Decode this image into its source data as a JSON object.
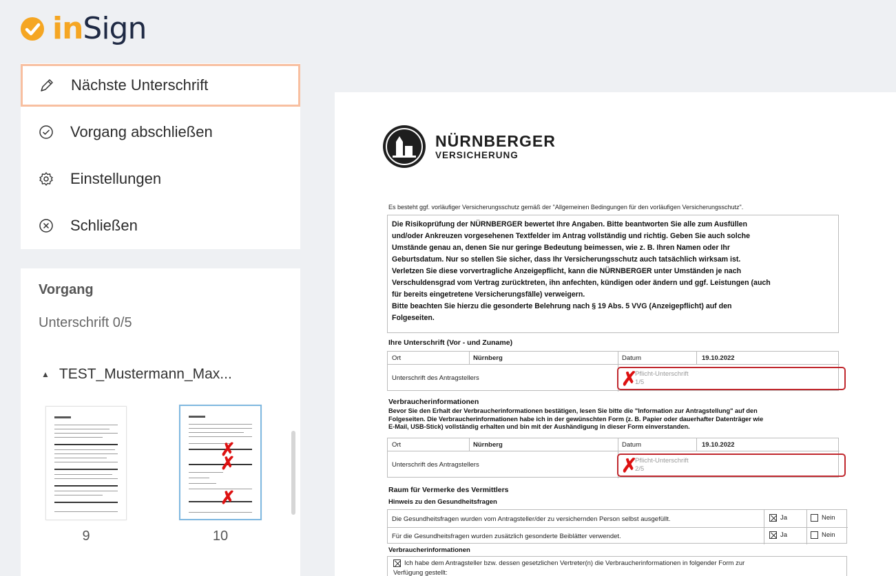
{
  "app": {
    "logo_in": "in",
    "logo_sign": "Sign"
  },
  "menu": {
    "items": [
      {
        "label": "Nächste Unterschrift",
        "icon": "pen-icon",
        "active": true
      },
      {
        "label": "Vorgang abschließen",
        "icon": "check-circle-icon"
      },
      {
        "label": "Einstellungen",
        "icon": "gear-icon"
      },
      {
        "label": "Schließen",
        "icon": "close-circle-icon"
      }
    ]
  },
  "process": {
    "title": "Vorgang",
    "signature_count": "Unterschrift 0/5",
    "document_name": "TEST_Mustermann_Max...",
    "pages": [
      {
        "number": "9"
      },
      {
        "number": "10",
        "selected": true
      }
    ]
  },
  "document": {
    "company_name": "NÜRNBERGER",
    "company_sub": "VERSICHERUNG",
    "intro": "Es besteht ggf. vorläufiger Versicherungsschutz gemäß der \"Allgemeinen Bedingungen für den vorläufigen Versicherungsschutz\".",
    "notice_lines": [
      "Die Risikoprüfung der NÜRNBERGER bewertet Ihre Angaben. Bitte beantworten Sie alle zum Ausfüllen",
      "und/oder Ankreuzen vorgesehenen Textfelder im Antrag vollständig und richtig. Geben Sie auch solche",
      "Umstände genau an, denen Sie nur geringe Bedeutung beimessen, wie z. B. Ihren Namen oder Ihr",
      "Geburtsdatum. Nur so stellen Sie sicher, dass Ihr Versicherungsschutz auch tatsächlich wirksam ist.",
      "Verletzen Sie diese vorvertragliche Anzeigepflicht, kann die NÜRNBERGER unter Umständen je nach",
      "Verschuldensgrad vom Vertrag zurücktreten, ihn anfechten, kündigen oder ändern und ggf. Leistungen (auch",
      "für bereits eingetretene Versicherungsfälle) verweigern.",
      "Bitte beachten Sie hierzu die gesonderte Belehrung nach § 19 Abs. 5 VVG (Anzeigepflicht) auf den",
      "Folgeseiten."
    ],
    "signature_section_title": "Ihre Unterschrift (Vor - und Zuname)",
    "sig_table_1": {
      "ort_label": "Ort",
      "ort_value": "Nürnberg",
      "datum_label": "Datum",
      "datum_value": "19.10.2022",
      "signer_label": "Unterschrift des Antragstellers",
      "sig_label": "Pflicht-Unterschrift",
      "sig_count": "1/5"
    },
    "consumer_title": "Verbraucherinformationen",
    "consumer_lines": [
      "Bevor Sie den Erhalt der Verbraucherinformationen bestätigen, lesen Sie bitte die \"Information zur Antragstellung\" auf den",
      "Folgeseiten. Die Verbraucherinformationen habe ich in der gewünschten Form (z. B. Papier oder dauerhafter Datenträger wie",
      "E-Mail, USB-Stick) vollständig erhalten und bin mit der Aushändigung in dieser Form einverstanden."
    ],
    "sig_table_2": {
      "ort_label": "Ort",
      "ort_value": "Nürnberg",
      "datum_label": "Datum",
      "datum_value": "19.10.2022",
      "signer_label": "Unterschrift des Antragstellers",
      "sig_label": "Pflicht-Unterschrift",
      "sig_count": "2/5"
    },
    "agent_title": "Raum für Vermerke des Vermittlers",
    "health_title": "Hinweis zu den Gesundheitsfragen",
    "health_rows": [
      {
        "text": "Die Gesundheitsfragen wurden vom Antragsteller/der zu versichernden Person selbst ausgefüllt.",
        "yes": "Ja",
        "no": "Nein"
      },
      {
        "text": "Für die Gesundheitsfragen wurden zusätzlich gesonderte Beiblätter verwendet.",
        "yes": "Ja",
        "no": "Nein"
      }
    ],
    "consumer_title_2": "Verbraucherinformationen",
    "last_line_1": "Ich habe dem Antragsteller bzw. dessen gesetzlichen Vertreter(n) die Verbraucherinformationen in folgender Form zur",
    "last_line_2": "Verfügung gestellt:"
  },
  "colors": {
    "accent": "#f5a623",
    "active_border": "#f8bfa0",
    "signature_red": "#c0272d",
    "selected_thumb": "#7fb8e0"
  }
}
